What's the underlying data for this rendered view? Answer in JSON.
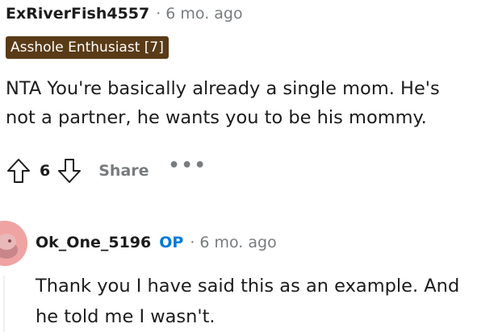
{
  "comment1": {
    "username": "ExRiverFish4557",
    "separator": "·",
    "timestamp": "6 mo. ago",
    "flair": "Asshole Enthusiast [7]",
    "body_line1": "NTA You're basically already a single mom. He's",
    "body_line2": "not a partner, he wants you to be his mommy.",
    "score": "6",
    "share_label": "Share",
    "more_label": "•••"
  },
  "comment2": {
    "username": "Ok_One_5196",
    "op_badge": "OP",
    "separator": "·",
    "timestamp": "6 mo. ago",
    "body_line1": "Thank you I have said this as an example. And",
    "body_line2": "he told me I wasn't."
  },
  "colors": {
    "flair_bg": "#5a3b17",
    "op_blue": "#0079d3",
    "muted": "#787c7e",
    "avatar_pink": "#f0a3a3"
  },
  "icons": {
    "upvote": "upvote-arrow-icon",
    "downvote": "downvote-arrow-icon",
    "more": "ellipsis-icon",
    "avatar": "snoo-avatar-icon"
  }
}
